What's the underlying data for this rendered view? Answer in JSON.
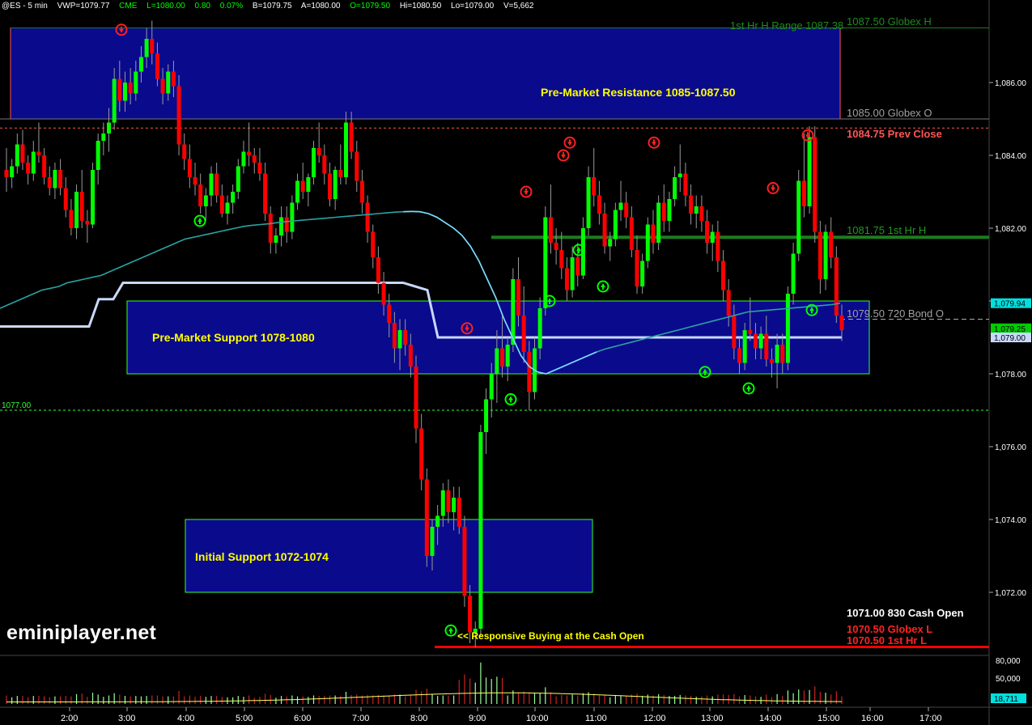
{
  "header": {
    "symbol": "@ES - 5 min",
    "vwp": "VWP=1079.77",
    "exchange": "CME",
    "last": "L=1080.00",
    "change": "0.80",
    "pct": "0.07%",
    "bid": "B=1079.75",
    "ask": "A=1080.00",
    "open": "O=1079.50",
    "high": "Hi=1080.50",
    "low": "Lo=1079.00",
    "volume": "V=5,662"
  },
  "brand": "eminiplayer.net",
  "colors": {
    "background": "#000000",
    "up_candle": "#00ff00",
    "down_candle": "#ff0000",
    "zone_fill": "#0a0a8c",
    "zone_border_green": "#33ff33",
    "vwap": "#2aa3a3",
    "bond_line": "#c8d8ff",
    "first_hr_high": "#1f7a1f"
  },
  "chart_data": {
    "type": "candlestick",
    "price_axis": {
      "ylim": [
        1070.5,
        1087.8
      ],
      "ticks": [
        "1,072.00",
        "1,074.00",
        "1,076.00",
        "1,078.00",
        "1,080.00",
        "1,082.00",
        "1,084.00",
        "1,086.00"
      ],
      "tick_values": [
        1072,
        1074,
        1076,
        1078,
        1080,
        1082,
        1084,
        1086
      ]
    },
    "time_axis": {
      "ticks": [
        "2:00",
        "3:00",
        "4:00",
        "5:00",
        "6:00",
        "7:00",
        "8:00",
        "9:00",
        "10:00",
        "11:00",
        "12:00",
        "13:00",
        "14:00",
        "15:00",
        "16:00",
        "17:00"
      ]
    },
    "axis_badges": [
      {
        "text": "1,079.94",
        "value": 1079.94,
        "bg": "#00e0e0",
        "fg": "#000000"
      },
      {
        "text": "1,079.25",
        "value": 1079.25,
        "bg": "#00cc00",
        "fg": "#000000"
      },
      {
        "text": "1,079.00",
        "value": 1079.0,
        "bg": "#c8d8ff",
        "fg": "#000000"
      }
    ],
    "zones": [
      {
        "label": "Pre-Market Resistance 1085-1087.50",
        "low": 1085.0,
        "high": 1087.5,
        "border": "#ff5555"
      },
      {
        "label": "Pre-Market Support 1078-1080",
        "low": 1078.0,
        "high": 1080.0,
        "border": "#33ff33"
      },
      {
        "label": "Initial Support 1072-1074",
        "low": 1072.0,
        "high": 1074.0,
        "border": "#33ff33"
      }
    ],
    "level_labels": [
      {
        "text": "1st Hr H Range 1087.38",
        "value": 1087.38,
        "color": "#1f8a1f"
      },
      {
        "text": "1087.50  Globex H",
        "value": 1087.5,
        "color": "#1f8a1f"
      },
      {
        "text": "1085.00  Globex O",
        "value": 1085.0,
        "color": "#a0a0a0"
      },
      {
        "text": "1084.75  Prev Close",
        "value": 1084.75,
        "color": "#ff5555"
      },
      {
        "text": "1081.75  1st Hr H",
        "value": 1081.75,
        "color": "#1f9a1f"
      },
      {
        "text": "1079.50  720 Bond O",
        "value": 1079.5,
        "color": "#a0a0a0"
      },
      {
        "text": "1077.00",
        "value": 1077.0,
        "color": "#33ff33"
      },
      {
        "text": "1071.00  830 Cash Open",
        "value": 1071.0,
        "color": "#ffffff"
      },
      {
        "text": "1070.50  Globex L",
        "value": 1070.5,
        "color": "#ff2222"
      },
      {
        "text": "1070.50  1st Hr L",
        "value": 1070.5,
        "color": "#ff2222"
      }
    ],
    "annotation": "<< Responsive Buying at the Cash Open",
    "volume_axis": {
      "ticks": [
        "80,000",
        "50,000"
      ],
      "tick_values": [
        80000,
        50000
      ],
      "last_badge": "18,711",
      "last_value": 18711
    },
    "candles_ohlc": [
      [
        1083.6,
        1084.2,
        1083.0,
        1083.4
      ],
      [
        1083.4,
        1083.9,
        1083.1,
        1083.7
      ],
      [
        1083.7,
        1084.6,
        1083.5,
        1084.3
      ],
      [
        1084.3,
        1084.7,
        1083.6,
        1083.8
      ],
      [
        1083.8,
        1084.0,
        1083.2,
        1083.5
      ],
      [
        1083.5,
        1084.4,
        1083.3,
        1084.1
      ],
      [
        1084.1,
        1084.9,
        1083.8,
        1084.0
      ],
      [
        1084.0,
        1084.2,
        1083.2,
        1083.4
      ],
      [
        1083.4,
        1083.7,
        1082.9,
        1083.1
      ],
      [
        1083.1,
        1083.8,
        1082.8,
        1083.6
      ],
      [
        1083.6,
        1083.9,
        1082.9,
        1083.1
      ],
      [
        1083.1,
        1083.4,
        1082.3,
        1082.5
      ],
      [
        1082.5,
        1082.8,
        1081.8,
        1082.0
      ],
      [
        1082.0,
        1083.2,
        1081.7,
        1083.0
      ],
      [
        1083.0,
        1083.6,
        1082.0,
        1082.2
      ],
      [
        1082.2,
        1082.5,
        1081.6,
        1082.1
      ],
      [
        1082.1,
        1083.8,
        1082.0,
        1083.6
      ],
      [
        1083.6,
        1084.6,
        1083.2,
        1084.4
      ],
      [
        1084.4,
        1084.9,
        1084.0,
        1084.6
      ],
      [
        1084.6,
        1085.3,
        1084.1,
        1084.9
      ],
      [
        1084.9,
        1086.4,
        1084.7,
        1086.1
      ],
      [
        1086.1,
        1086.6,
        1085.2,
        1085.5
      ],
      [
        1085.5,
        1086.3,
        1085.2,
        1086.0
      ],
      [
        1086.0,
        1086.4,
        1085.4,
        1085.7
      ],
      [
        1085.7,
        1086.6,
        1085.5,
        1086.3
      ],
      [
        1086.3,
        1087.0,
        1086.0,
        1086.7
      ],
      [
        1086.7,
        1087.5,
        1086.4,
        1087.2
      ],
      [
        1087.2,
        1087.7,
        1086.5,
        1086.8
      ],
      [
        1086.8,
        1087.1,
        1085.9,
        1086.1
      ],
      [
        1086.1,
        1086.4,
        1085.4,
        1085.7
      ],
      [
        1085.7,
        1086.5,
        1085.5,
        1086.3
      ],
      [
        1086.3,
        1086.6,
        1085.6,
        1085.9
      ],
      [
        1085.9,
        1086.2,
        1084.0,
        1084.3
      ],
      [
        1084.3,
        1084.6,
        1083.6,
        1083.9
      ],
      [
        1083.9,
        1084.3,
        1083.1,
        1083.4
      ],
      [
        1083.4,
        1083.8,
        1082.9,
        1083.2
      ],
      [
        1083.2,
        1083.5,
        1082.4,
        1082.6
      ],
      [
        1082.6,
        1083.1,
        1082.2,
        1082.9
      ],
      [
        1082.9,
        1083.7,
        1082.6,
        1083.5
      ],
      [
        1083.5,
        1083.8,
        1082.7,
        1082.9
      ],
      [
        1082.9,
        1083.2,
        1082.3,
        1082.4
      ],
      [
        1082.4,
        1082.9,
        1082.1,
        1082.7
      ],
      [
        1082.7,
        1083.2,
        1082.4,
        1083.0
      ],
      [
        1083.0,
        1083.9,
        1082.8,
        1083.7
      ],
      [
        1083.7,
        1084.4,
        1083.5,
        1084.1
      ],
      [
        1084.1,
        1084.9,
        1083.7,
        1084.0
      ],
      [
        1084.0,
        1084.2,
        1083.5,
        1083.8
      ],
      [
        1083.8,
        1084.2,
        1083.3,
        1083.5
      ],
      [
        1083.5,
        1083.8,
        1082.2,
        1082.4
      ],
      [
        1082.4,
        1082.6,
        1081.3,
        1081.6
      ],
      [
        1081.6,
        1082.0,
        1081.3,
        1081.8
      ],
      [
        1081.8,
        1082.6,
        1081.5,
        1082.3
      ],
      [
        1082.3,
        1082.6,
        1081.6,
        1081.9
      ],
      [
        1081.9,
        1082.9,
        1081.7,
        1082.7
      ],
      [
        1082.7,
        1083.5,
        1082.5,
        1083.3
      ],
      [
        1083.3,
        1083.8,
        1082.8,
        1083.0
      ],
      [
        1083.0,
        1083.5,
        1082.6,
        1083.4
      ],
      [
        1083.4,
        1084.4,
        1083.2,
        1084.2
      ],
      [
        1084.2,
        1084.9,
        1083.8,
        1084.0
      ],
      [
        1084.0,
        1084.3,
        1083.2,
        1083.5
      ],
      [
        1083.5,
        1083.8,
        1082.6,
        1082.8
      ],
      [
        1082.8,
        1083.7,
        1082.5,
        1083.6
      ],
      [
        1083.6,
        1084.3,
        1083.2,
        1083.4
      ],
      [
        1083.4,
        1085.2,
        1083.2,
        1084.9
      ],
      [
        1084.9,
        1085.2,
        1083.9,
        1084.1
      ],
      [
        1084.1,
        1084.4,
        1083.0,
        1083.3
      ],
      [
        1083.3,
        1083.6,
        1082.4,
        1082.7
      ],
      [
        1082.7,
        1082.9,
        1081.6,
        1081.9
      ],
      [
        1081.9,
        1082.1,
        1080.9,
        1081.2
      ],
      [
        1081.2,
        1081.5,
        1080.2,
        1080.5
      ],
      [
        1080.5,
        1080.8,
        1079.6,
        1079.9
      ],
      [
        1079.9,
        1080.2,
        1079.0,
        1079.4
      ],
      [
        1079.4,
        1079.7,
        1078.3,
        1078.7
      ],
      [
        1078.7,
        1079.5,
        1078.1,
        1079.2
      ],
      [
        1079.2,
        1079.5,
        1078.5,
        1078.8
      ],
      [
        1078.8,
        1079.1,
        1077.9,
        1078.2
      ],
      [
        1078.2,
        1078.5,
        1076.1,
        1076.5
      ],
      [
        1076.5,
        1076.9,
        1074.8,
        1075.1
      ],
      [
        1075.1,
        1075.4,
        1072.7,
        1073.0
      ],
      [
        1073.0,
        1074.0,
        1072.6,
        1073.8
      ],
      [
        1073.8,
        1074.4,
        1073.3,
        1074.1
      ],
      [
        1074.1,
        1075.0,
        1073.8,
        1074.8
      ],
      [
        1074.8,
        1075.1,
        1073.9,
        1074.2
      ],
      [
        1074.2,
        1074.9,
        1073.7,
        1074.6
      ],
      [
        1074.6,
        1074.9,
        1073.6,
        1073.8
      ],
      [
        1073.8,
        1074.1,
        1071.6,
        1071.9
      ],
      [
        1071.9,
        1072.2,
        1070.6,
        1070.9
      ],
      [
        1070.9,
        1071.2,
        1070.5,
        1071.0
      ],
      [
        1071.0,
        1076.6,
        1070.8,
        1076.4
      ],
      [
        1076.4,
        1077.6,
        1075.8,
        1077.3
      ],
      [
        1077.3,
        1078.3,
        1076.8,
        1078.0
      ],
      [
        1078.0,
        1079.2,
        1077.2,
        1078.7
      ],
      [
        1078.7,
        1079.6,
        1077.9,
        1078.2
      ],
      [
        1078.2,
        1079.0,
        1077.8,
        1078.8
      ],
      [
        1078.8,
        1080.9,
        1078.6,
        1080.6
      ],
      [
        1080.6,
        1081.2,
        1079.3,
        1079.6
      ],
      [
        1079.6,
        1080.4,
        1078.3,
        1078.6
      ],
      [
        1078.6,
        1078.9,
        1077.0,
        1077.5
      ],
      [
        1077.5,
        1079.0,
        1077.3,
        1078.7
      ],
      [
        1078.7,
        1080.1,
        1078.4,
        1079.8
      ],
      [
        1079.8,
        1082.6,
        1079.6,
        1082.3
      ],
      [
        1082.3,
        1083.2,
        1081.3,
        1081.6
      ],
      [
        1081.6,
        1082.0,
        1081.0,
        1081.4
      ],
      [
        1081.4,
        1081.9,
        1080.6,
        1080.9
      ],
      [
        1080.9,
        1081.2,
        1080.0,
        1080.3
      ],
      [
        1080.3,
        1081.5,
        1080.1,
        1081.2
      ],
      [
        1081.2,
        1081.6,
        1080.4,
        1080.7
      ],
      [
        1080.7,
        1082.3,
        1080.6,
        1082.0
      ],
      [
        1082.0,
        1083.7,
        1081.8,
        1083.4
      ],
      [
        1083.4,
        1084.2,
        1082.6,
        1082.9
      ],
      [
        1082.9,
        1083.3,
        1082.1,
        1082.4
      ],
      [
        1082.4,
        1082.7,
        1081.3,
        1081.5
      ],
      [
        1081.5,
        1081.9,
        1081.1,
        1081.7
      ],
      [
        1081.7,
        1082.7,
        1081.5,
        1082.5
      ],
      [
        1082.5,
        1083.3,
        1082.2,
        1082.7
      ],
      [
        1082.7,
        1083.0,
        1082.0,
        1082.3
      ],
      [
        1082.3,
        1082.6,
        1081.2,
        1081.4
      ],
      [
        1081.4,
        1081.8,
        1080.2,
        1080.4
      ],
      [
        1080.4,
        1081.3,
        1080.2,
        1081.1
      ],
      [
        1081.1,
        1082.3,
        1080.9,
        1082.1
      ],
      [
        1082.1,
        1082.5,
        1081.3,
        1081.6
      ],
      [
        1081.6,
        1082.9,
        1081.4,
        1082.7
      ],
      [
        1082.7,
        1083.2,
        1081.9,
        1082.2
      ],
      [
        1082.2,
        1083.0,
        1081.9,
        1082.8
      ],
      [
        1082.8,
        1083.7,
        1082.6,
        1083.4
      ],
      [
        1083.4,
        1084.3,
        1083.0,
        1083.5
      ],
      [
        1083.5,
        1083.8,
        1082.6,
        1082.9
      ],
      [
        1082.9,
        1083.2,
        1082.1,
        1082.4
      ],
      [
        1082.4,
        1082.9,
        1082.0,
        1082.6
      ],
      [
        1082.6,
        1082.9,
        1081.9,
        1082.2
      ],
      [
        1082.2,
        1082.5,
        1081.3,
        1081.6
      ],
      [
        1081.6,
        1082.1,
        1081.1,
        1081.9
      ],
      [
        1081.9,
        1082.2,
        1080.8,
        1081.1
      ],
      [
        1081.1,
        1081.4,
        1080.0,
        1080.3
      ],
      [
        1080.3,
        1080.6,
        1079.3,
        1079.6
      ],
      [
        1079.6,
        1079.9,
        1078.4,
        1078.7
      ],
      [
        1078.7,
        1079.0,
        1078.0,
        1078.3
      ],
      [
        1078.3,
        1079.4,
        1078.1,
        1079.2
      ],
      [
        1079.2,
        1080.1,
        1078.9,
        1079.1
      ],
      [
        1079.1,
        1079.4,
        1078.4,
        1078.7
      ],
      [
        1078.7,
        1079.3,
        1078.4,
        1079.1
      ],
      [
        1079.1,
        1079.6,
        1078.2,
        1078.4
      ],
      [
        1078.4,
        1078.7,
        1077.9,
        1078.3
      ],
      [
        1078.3,
        1079.1,
        1077.6,
        1078.8
      ],
      [
        1078.8,
        1079.1,
        1078.0,
        1078.3
      ],
      [
        1078.3,
        1080.4,
        1078.1,
        1080.2
      ],
      [
        1080.2,
        1081.6,
        1079.9,
        1081.3
      ],
      [
        1081.3,
        1083.6,
        1081.1,
        1083.3
      ],
      [
        1083.3,
        1084.6,
        1082.3,
        1082.6
      ],
      [
        1082.6,
        1084.8,
        1082.4,
        1084.5
      ],
      [
        1084.5,
        1084.8,
        1081.6,
        1081.9
      ],
      [
        1081.9,
        1082.2,
        1080.2,
        1080.6
      ],
      [
        1080.6,
        1082.1,
        1080.3,
        1081.9
      ],
      [
        1081.9,
        1082.3,
        1080.9,
        1081.2
      ],
      [
        1081.2,
        1081.5,
        1079.4,
        1079.6
      ],
      [
        1079.6,
        1079.9,
        1078.9,
        1079.2
      ]
    ],
    "vwap_series": [
      1079.8,
      1079.9,
      1080.0,
      1080.1,
      1080.2,
      1080.3,
      1080.35,
      1080.4,
      1080.5,
      1080.55,
      1080.6,
      1080.65,
      1080.7,
      1080.8,
      1080.9,
      1081.0,
      1081.1,
      1081.2,
      1081.3,
      1081.4,
      1081.5,
      1081.6,
      1081.7,
      1081.75,
      1081.8,
      1081.85,
      1081.9,
      1081.95,
      1082.0,
      1082.05,
      1082.08,
      1082.1,
      1082.12,
      1082.15,
      1082.18,
      1082.2,
      1082.22,
      1082.24,
      1082.26,
      1082.28,
      1082.3,
      1082.32,
      1082.34,
      1082.36,
      1082.38,
      1082.4,
      1082.42,
      1082.44,
      1082.45,
      1082.46,
      1082.45,
      1082.4,
      1082.3,
      1082.15,
      1082.0,
      1081.8,
      1081.5,
      1081.1,
      1080.6,
      1080.1,
      1079.5,
      1079.0,
      1078.5,
      1078.2,
      1078.05,
      1078.0,
      1078.1,
      1078.2,
      1078.3,
      1078.4,
      1078.5,
      1078.6,
      1078.68,
      1078.74,
      1078.8,
      1078.86,
      1078.92,
      1078.98,
      1079.04,
      1079.1,
      1079.16,
      1079.22,
      1079.28,
      1079.34,
      1079.4,
      1079.46,
      1079.52,
      1079.58,
      1079.64,
      1079.7,
      1079.72,
      1079.74,
      1079.76,
      1079.78,
      1079.8,
      1079.82,
      1079.84,
      1079.86,
      1079.88,
      1079.9,
      1079.94
    ]
  }
}
